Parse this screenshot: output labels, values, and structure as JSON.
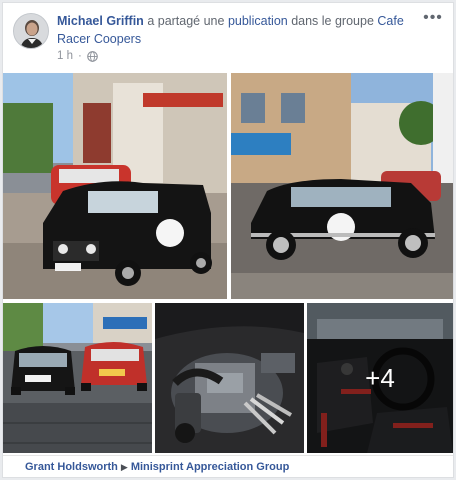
{
  "post": {
    "author": "Michael Griffin",
    "action_text": "a partagé une",
    "publication_link": "publication",
    "in_group_text": "dans le groupe",
    "group_name": "Cafe Racer Coopers",
    "timestamp": "1 h",
    "privacy_icon": "globe-icon",
    "more_icon": "more-options-icon",
    "photos_more_count": "+4"
  },
  "shared_from": {
    "author": "Grant Holdsworth",
    "group": "Minisprint Appreciation Group"
  },
  "colors": {
    "link": "#365899",
    "meta": "#90949c",
    "background": "#e9ebee"
  }
}
